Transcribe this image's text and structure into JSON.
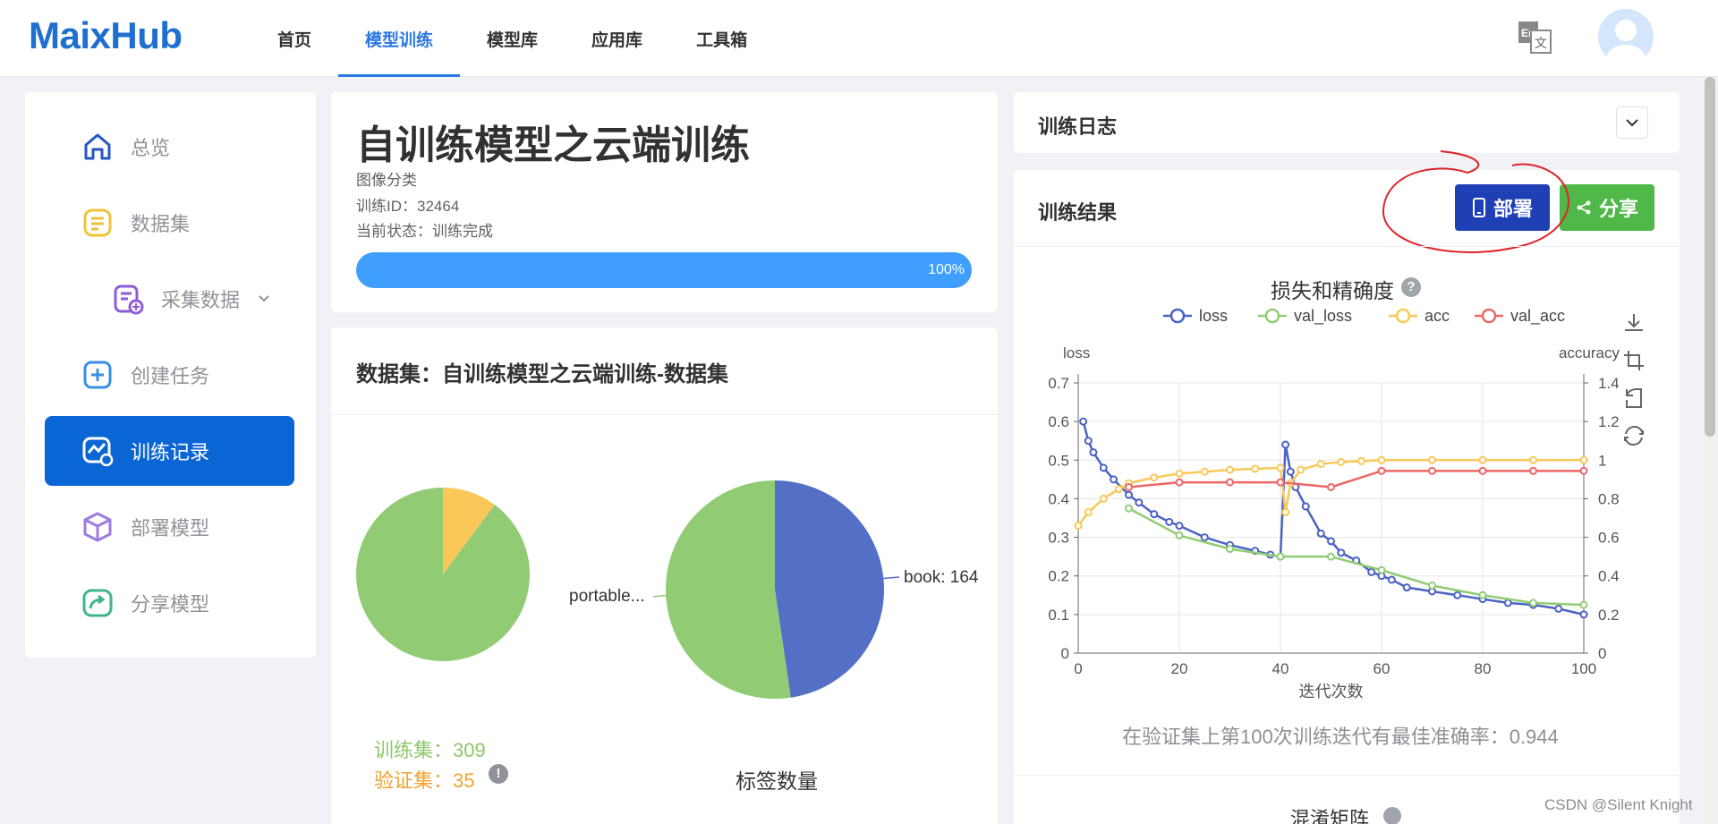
{
  "app": {
    "logo": "MaixHub"
  },
  "nav": {
    "items": [
      "首页",
      "模型训练",
      "模型库",
      "应用库",
      "工具箱"
    ],
    "active": "模型训练",
    "lang_icon": "translate-icon"
  },
  "sidebar": {
    "items": [
      {
        "label": "总览",
        "icon": "home-icon"
      },
      {
        "label": "数据集",
        "icon": "dataset-icon"
      },
      {
        "label": "采集数据",
        "icon": "collect-icon"
      },
      {
        "label": "创建任务",
        "icon": "plus-square-icon"
      },
      {
        "label": "训练记录",
        "icon": "chart-record-icon"
      },
      {
        "label": "部署模型",
        "icon": "cube-icon"
      },
      {
        "label": "分享模型",
        "icon": "share-icon"
      }
    ],
    "active": "训练记录"
  },
  "task": {
    "title": "自训练模型之云端训练",
    "type": "图像分类",
    "id_line": "训练ID：32464",
    "status_line": "当前状态：训练完成",
    "progress_pct": 100,
    "progress_label": "100%"
  },
  "dataset": {
    "title": "数据集：自训练模型之云端训练-数据集",
    "train_label": "训练集：309",
    "val_label": "验证集：35",
    "help": "!",
    "pie1": {
      "slices": [
        {
          "value": 309,
          "color": "#91cc75"
        },
        {
          "value": 35,
          "color": "#fac858"
        }
      ]
    },
    "pie2": {
      "caption": "标签数量",
      "slices": [
        {
          "label": "book: 164",
          "value": 164,
          "color": "#5470c6"
        },
        {
          "label": "portable...",
          "value": 180,
          "color": "#91cc75"
        }
      ]
    }
  },
  "log": {
    "title": "训练日志"
  },
  "results": {
    "title": "训练结果",
    "deploy_label": "部署",
    "share_label": "分享",
    "chart_title": "损失和精确度",
    "help": "?",
    "best_text": "在验证集上第100次训练迭代有最佳准确率：0.944",
    "cm_title": "混淆矩阵"
  },
  "watermark": "CSDN @Silent Knight",
  "chart_data": {
    "type": "line",
    "title": "损失和精确度",
    "xlabel": "迭代次数",
    "ylabel_left": "loss",
    "ylabel_right": "accuracy",
    "xlim": [
      0,
      100
    ],
    "ylim_left": [
      0,
      0.7
    ],
    "ylim_right": [
      0,
      1.4
    ],
    "xticks": [
      0,
      20,
      40,
      60,
      80,
      100
    ],
    "yticks_left": [
      0,
      0.1,
      0.2,
      0.3,
      0.4,
      0.5,
      0.6,
      0.7
    ],
    "yticks_right": [
      0,
      0.2,
      0.4,
      0.6,
      0.8,
      1,
      1.2,
      1.4
    ],
    "legend": "top-center",
    "grid": true,
    "series": [
      {
        "name": "loss",
        "axis": "left",
        "color": "#4a63c4",
        "points": [
          [
            1,
            0.6
          ],
          [
            2,
            0.55
          ],
          [
            3,
            0.52
          ],
          [
            5,
            0.48
          ],
          [
            7,
            0.45
          ],
          [
            10,
            0.41
          ],
          [
            12,
            0.39
          ],
          [
            15,
            0.36
          ],
          [
            18,
            0.34
          ],
          [
            20,
            0.33
          ],
          [
            25,
            0.3
          ],
          [
            30,
            0.28
          ],
          [
            35,
            0.265
          ],
          [
            38,
            0.255
          ],
          [
            40,
            0.25
          ],
          [
            41,
            0.54
          ],
          [
            42,
            0.47
          ],
          [
            43,
            0.43
          ],
          [
            45,
            0.38
          ],
          [
            48,
            0.31
          ],
          [
            50,
            0.29
          ],
          [
            52,
            0.26
          ],
          [
            55,
            0.24
          ],
          [
            58,
            0.21
          ],
          [
            60,
            0.2
          ],
          [
            62,
            0.19
          ],
          [
            65,
            0.17
          ],
          [
            70,
            0.16
          ],
          [
            75,
            0.15
          ],
          [
            80,
            0.14
          ],
          [
            85,
            0.13
          ],
          [
            90,
            0.125
          ],
          [
            95,
            0.115
          ],
          [
            100,
            0.1
          ]
        ]
      },
      {
        "name": "val_loss",
        "axis": "left",
        "color": "#91cc75",
        "points": [
          [
            10,
            0.375
          ],
          [
            20,
            0.305
          ],
          [
            30,
            0.27
          ],
          [
            40,
            0.25
          ],
          [
            50,
            0.25
          ],
          [
            60,
            0.215
          ],
          [
            70,
            0.175
          ],
          [
            80,
            0.15
          ],
          [
            90,
            0.13
          ],
          [
            100,
            0.125
          ]
        ]
      },
      {
        "name": "acc",
        "axis": "right",
        "color": "#fac858",
        "points": [
          [
            0,
            0.66
          ],
          [
            2,
            0.73
          ],
          [
            5,
            0.8
          ],
          [
            8,
            0.85
          ],
          [
            10,
            0.88
          ],
          [
            15,
            0.91
          ],
          [
            20,
            0.93
          ],
          [
            25,
            0.94
          ],
          [
            30,
            0.95
          ],
          [
            35,
            0.955
          ],
          [
            40,
            0.96
          ],
          [
            41,
            0.73
          ],
          [
            42,
            0.88
          ],
          [
            44,
            0.95
          ],
          [
            48,
            0.98
          ],
          [
            52,
            0.99
          ],
          [
            56,
            0.995
          ],
          [
            60,
            1.0
          ],
          [
            70,
            1.0
          ],
          [
            80,
            1.0
          ],
          [
            90,
            1.0
          ],
          [
            100,
            1.0
          ]
        ]
      },
      {
        "name": "val_acc",
        "axis": "right",
        "color": "#ee6666",
        "points": [
          [
            10,
            0.86
          ],
          [
            20,
            0.885
          ],
          [
            30,
            0.885
          ],
          [
            40,
            0.885
          ],
          [
            50,
            0.86
          ],
          [
            60,
            0.944
          ],
          [
            70,
            0.944
          ],
          [
            80,
            0.944
          ],
          [
            90,
            0.944
          ],
          [
            100,
            0.944
          ]
        ]
      }
    ]
  }
}
